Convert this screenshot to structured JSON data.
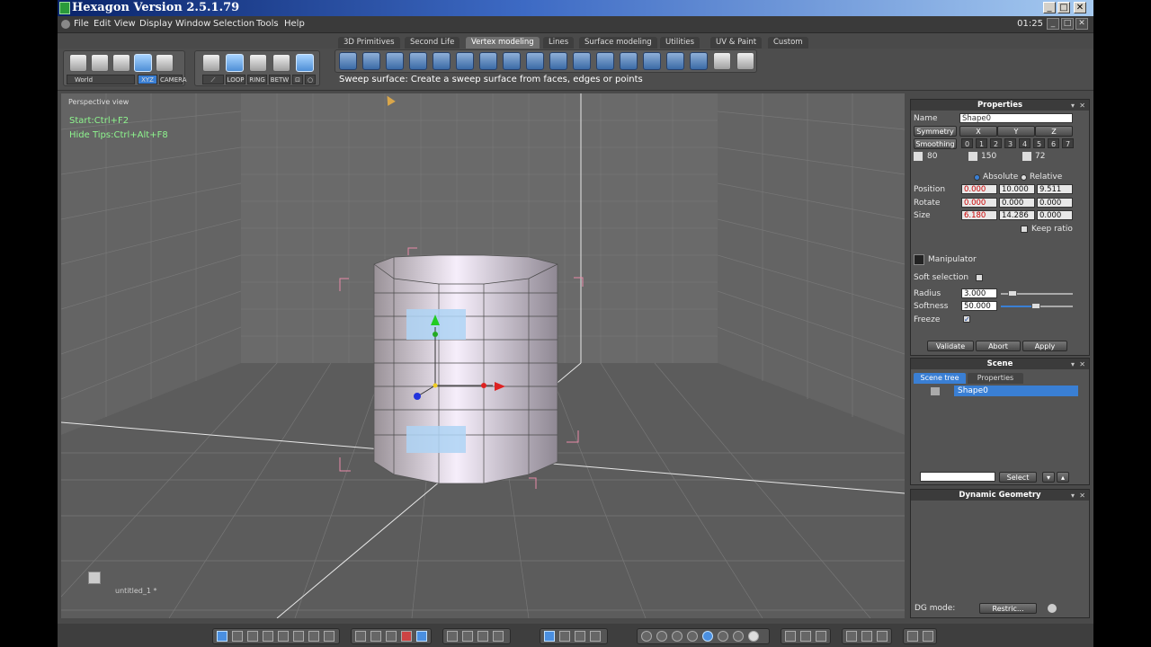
{
  "window": {
    "title": "Hexagon Version 2.5.1.79",
    "time": "01:25"
  },
  "menu": [
    "File",
    "Edit",
    "View",
    "Display",
    "Window",
    "Selection",
    "Tools",
    "Help"
  ],
  "tabs": [
    {
      "label": "3D Primitives",
      "active": false
    },
    {
      "label": "Second Life",
      "active": false
    },
    {
      "label": "Vertex modeling",
      "active": true
    },
    {
      "label": "Lines",
      "active": false
    },
    {
      "label": "Surface modeling",
      "active": false
    },
    {
      "label": "Utilities",
      "active": false
    },
    {
      "label": "UV & Paint",
      "active": false
    },
    {
      "label": "Custom",
      "active": false
    }
  ],
  "toolbar": {
    "coord_system": "World",
    "xyz_label": "XYZ",
    "camera_label": "CAMERA",
    "loop_label": "LOOP",
    "ring_label": "RING",
    "betw_label": "BETW",
    "tooltip": "Sweep surface: Create a sweep surface from faces, edges or points"
  },
  "viewport": {
    "label": "Perspective view",
    "tip1": "Start:Ctrl+F2",
    "tip2": "Hide Tips:Ctrl+Alt+F8",
    "filename": "untitled_1 *"
  },
  "properties": {
    "title": "Properties",
    "name_label": "Name",
    "name_value": "Shape0",
    "symmetry_label": "Symmetry",
    "axes": [
      "X",
      "Y",
      "Z"
    ],
    "smoothing_label": "Smoothing",
    "smoothing_levels": [
      "0",
      "1",
      "2",
      "3",
      "4",
      "5",
      "6",
      "7"
    ],
    "counts": [
      "80",
      "150",
      "72"
    ],
    "absolute_label": "Absolute",
    "relative_label": "Relative",
    "position_label": "Position",
    "position": [
      "0.000",
      "10.000",
      "9.511"
    ],
    "rotate_label": "Rotate",
    "rotate": [
      "0.000",
      "0.000",
      "0.000"
    ],
    "size_label": "Size",
    "size": [
      "6.180",
      "14.286",
      "0.000"
    ],
    "keep_ratio": "Keep ratio",
    "manipulator": "Manipulator",
    "soft_selection": "Soft selection",
    "radius_label": "Radius",
    "radius_value": "3.000",
    "softness_label": "Softness",
    "softness_value": "50.000",
    "freeze_label": "Freeze",
    "validate": "Validate",
    "abort": "Abort",
    "apply": "Apply"
  },
  "scene": {
    "title": "Scene",
    "tab_tree": "Scene tree",
    "tab_props": "Properties",
    "item": "Shape0",
    "select_btn": "Select"
  },
  "dynamic_geometry": {
    "title": "Dynamic Geometry",
    "mode_label": "DG mode:",
    "mode_value": "Restric..."
  },
  "colors": {
    "accent": "#3a7fd4",
    "tips": "#8ef58e",
    "field_text": "#cc0000"
  }
}
